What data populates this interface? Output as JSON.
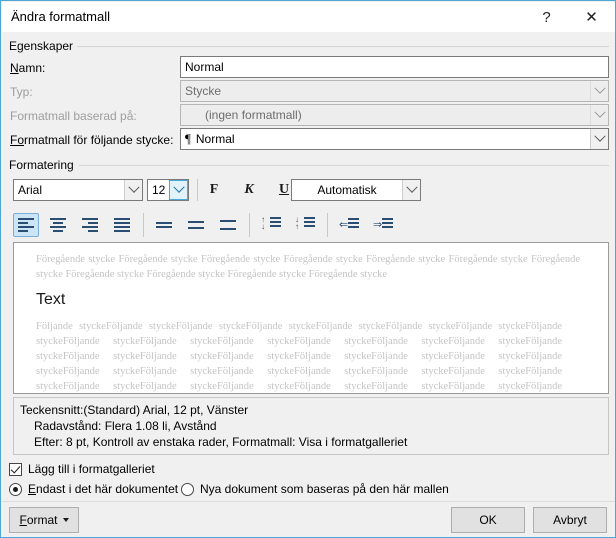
{
  "window": {
    "title": "Ändra formatmall",
    "help_icon": "?",
    "close_icon": "✕"
  },
  "properties": {
    "group_label": "Egenskaper",
    "name_label": "Namn:",
    "name_label_accel": "N",
    "name_value": "Normal",
    "type_label": "Typ:",
    "type_value": "Stycke",
    "based_on_label": "Formatmall baserad på:",
    "based_on_value": "(ingen formatmall)",
    "next_style_label": "Formatmall för följande stycke:",
    "next_style_accel": "Fo",
    "next_style_value": "Normal",
    "next_style_glyph": "¶"
  },
  "formatting": {
    "group_label": "Formatering",
    "font_family": "Arial",
    "font_size": "12",
    "bold_label": "F",
    "italic_label": "K",
    "underline_label": "U",
    "color_value": "Automatisk",
    "align_buttons": [
      {
        "name": "align-left-button",
        "active": true
      },
      {
        "name": "align-center-button",
        "active": false
      },
      {
        "name": "align-right-button",
        "active": false
      },
      {
        "name": "align-justify-button",
        "active": false
      }
    ],
    "linespacing_buttons": [
      {
        "name": "line-spacing-single-button"
      },
      {
        "name": "line-spacing-1-5-button"
      },
      {
        "name": "line-spacing-double-button"
      }
    ],
    "spacing_buttons": [
      {
        "name": "increase-paragraph-spacing-button"
      },
      {
        "name": "decrease-paragraph-spacing-button"
      }
    ],
    "indent_buttons": [
      {
        "name": "decrease-indent-button"
      },
      {
        "name": "increase-indent-button"
      }
    ]
  },
  "preview": {
    "before_text": "Föregående stycke Föregående stycke Föregående stycke Föregående stycke Föregående stycke Föregående stycke Föregående stycke Föregående stycke Föregående stycke Föregående stycke Föregående stycke",
    "sample_text": "Text",
    "after_text": "Följande styckeFöljande styckeFöljande styckeFöljande styckeFöljande styckeFöljande styckeFöljande styckeFöljande styckeFöljande styckeFöljande styckeFöljande styckeFöljande styckeFöljande styckeFöljande styckeFöljande styckeFöljande styckeFöljande styckeFöljande styckeFöljande styckeFöljande styckeFöljande styckeFöljande styckeFöljande styckeFöljande styckeFöljande styckeFöljande styckeFöljande styckeFöljande styckeFöljande styckeFöljande styckeFöljande styckeFöljande styckeFöljande styckeFöljande styckeFöljande styckeFöljande styckeFöljande styckeFöljande styckeFöljande styckeFöljande styckeFöljande"
  },
  "description": {
    "line1": "Teckensnitt:(Standard) Arial, 12 pt, Vänster",
    "line2": "Radavstånd:  Flera 1.08 li, Avstånd",
    "line3": "Efter:  8 pt, Kontroll av enstaka rader, Formatmall: Visa i formatgalleriet"
  },
  "options": {
    "add_to_gallery_label": "Lägg till i formatgalleriet",
    "add_to_gallery_checked": true,
    "scope_this_doc_label": "Endast i det här dokumentet",
    "scope_this_doc_accel": "E",
    "scope_this_doc_selected": true,
    "scope_new_docs_label": "Nya dokument som baseras på den här mallen",
    "scope_new_docs_selected": false
  },
  "footer": {
    "format_label": "Format",
    "format_accel": "F",
    "ok_label": "OK",
    "cancel_label": "Avbryt"
  },
  "colors": {
    "dialog_bg": "#f0f0f0",
    "frame": "#4ca6d9",
    "accent_icon": "#2a4d73",
    "active_button_bg": "#cce5f6",
    "preview_gray": "#c4c4c4"
  }
}
